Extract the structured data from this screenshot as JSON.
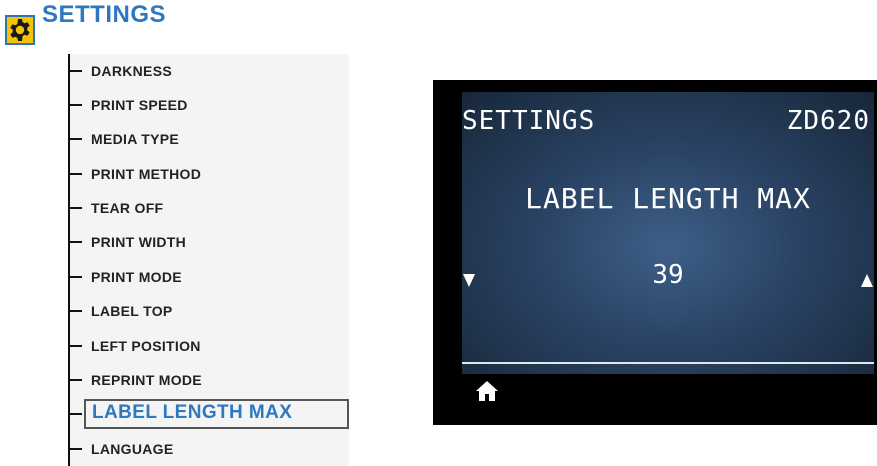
{
  "header": {
    "icon": "gear-icon",
    "title": "SETTINGS",
    "colors": {
      "title": "#2d78c0",
      "icon_bg": "#f5c400"
    }
  },
  "menu": {
    "items": [
      {
        "label": "DARKNESS"
      },
      {
        "label": "PRINT SPEED"
      },
      {
        "label": "MEDIA TYPE"
      },
      {
        "label": "PRINT METHOD"
      },
      {
        "label": "TEAR OFF"
      },
      {
        "label": "PRINT WIDTH"
      },
      {
        "label": "PRINT MODE"
      },
      {
        "label": "LABEL TOP"
      },
      {
        "label": "LEFT POSITION"
      },
      {
        "label": "REPRINT MODE"
      },
      {
        "label": "LABEL LENGTH MAX",
        "selected": true
      },
      {
        "label": "LANGUAGE"
      }
    ]
  },
  "screen": {
    "header_left": "SETTINGS",
    "header_right": "ZD620",
    "setting_name": "LABEL LENGTH MAX",
    "value": "39",
    "left_arrow": "arrow-down-icon",
    "right_arrow": "arrow-up-icon",
    "home_icon": "home-icon"
  }
}
